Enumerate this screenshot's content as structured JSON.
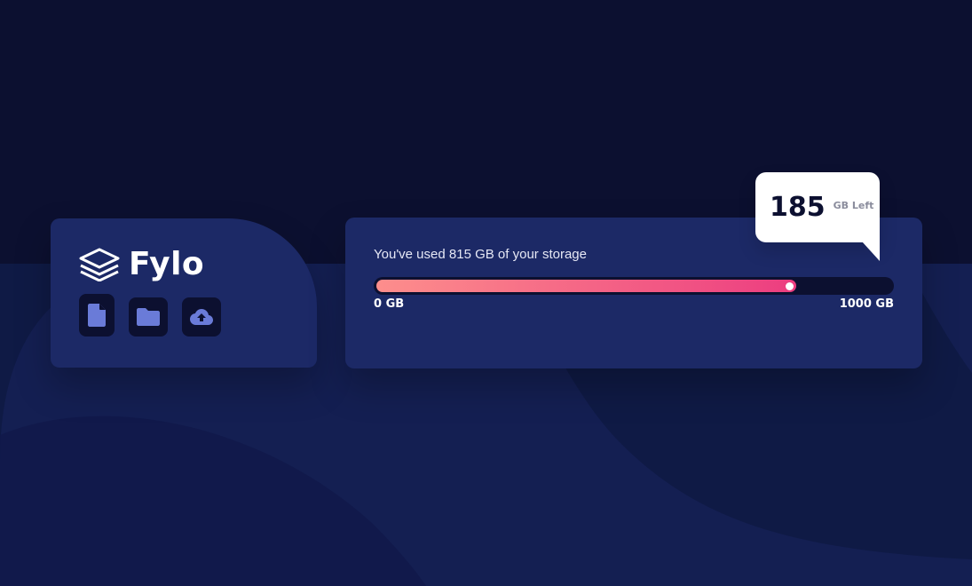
{
  "logo": {
    "text": "Fylo"
  },
  "icons": [
    {
      "name": "file-icon"
    },
    {
      "name": "folder-icon"
    },
    {
      "name": "upload-icon"
    }
  ],
  "storage": {
    "text_prefix": "You've used ",
    "used_value": "815 GB",
    "text_suffix": " of your storage",
    "used_gb": 815,
    "total_gb": 1000,
    "min_label": "0 GB",
    "max_label": "1000 GB"
  },
  "remaining": {
    "value": "185",
    "unit": "GB Left"
  },
  "colors": {
    "background": "#0c1030",
    "card": "#1c2966",
    "icon": "#6a7bd8",
    "gradient_start": "#fd8e8c",
    "gradient_end": "#ec3d80"
  }
}
